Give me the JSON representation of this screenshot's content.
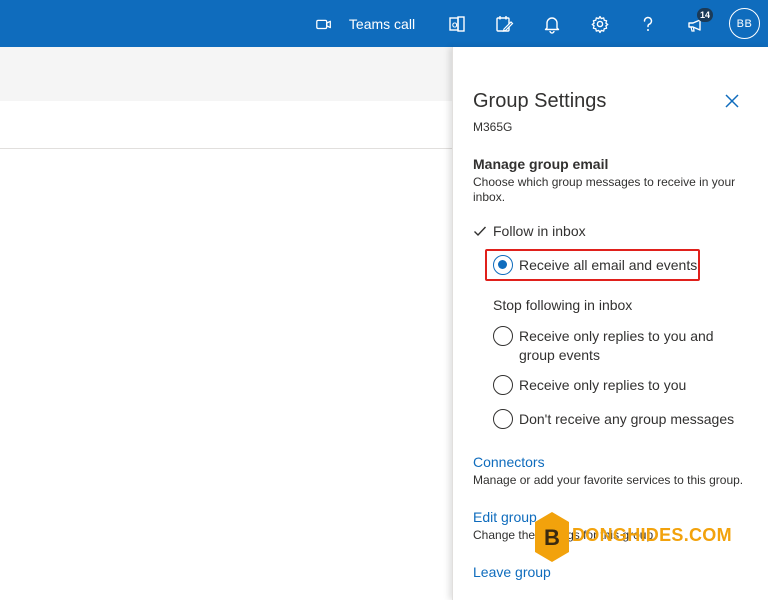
{
  "topbar": {
    "teams_call_label": "Teams call",
    "notification_count": "14",
    "avatar_initials": "BB",
    "icons": [
      "video-icon",
      "office-apps-icon",
      "my-day-icon",
      "bell-icon",
      "gear-icon",
      "help-icon",
      "megaphone-icon"
    ]
  },
  "panel": {
    "title": "Group Settings",
    "group_name": "M365G",
    "manage_heading": "Manage group email",
    "manage_desc": "Choose which group messages to receive in your inbox.",
    "follow_label": "Follow in inbox",
    "option_all": "Receive all email and events",
    "stop_label": "Stop following in inbox",
    "option_replies_events": "Receive only replies to you and group events",
    "option_replies": "Receive only replies to you",
    "option_none": "Don't receive any group messages",
    "selected_option": "Receive all email and events",
    "connectors_link": "Connectors",
    "connectors_desc": "Manage or add your favorite services to this group.",
    "edit_group_link": "Edit group",
    "edit_group_desc": "Change the settings for this group.",
    "leave_group_link": "Leave group"
  },
  "watermark": {
    "text": "DONGHIDES.COM",
    "letter": "B"
  },
  "colors": {
    "brand": "#0f6cbd",
    "highlight": "#e0201b",
    "watermark": "#f2a20c"
  }
}
